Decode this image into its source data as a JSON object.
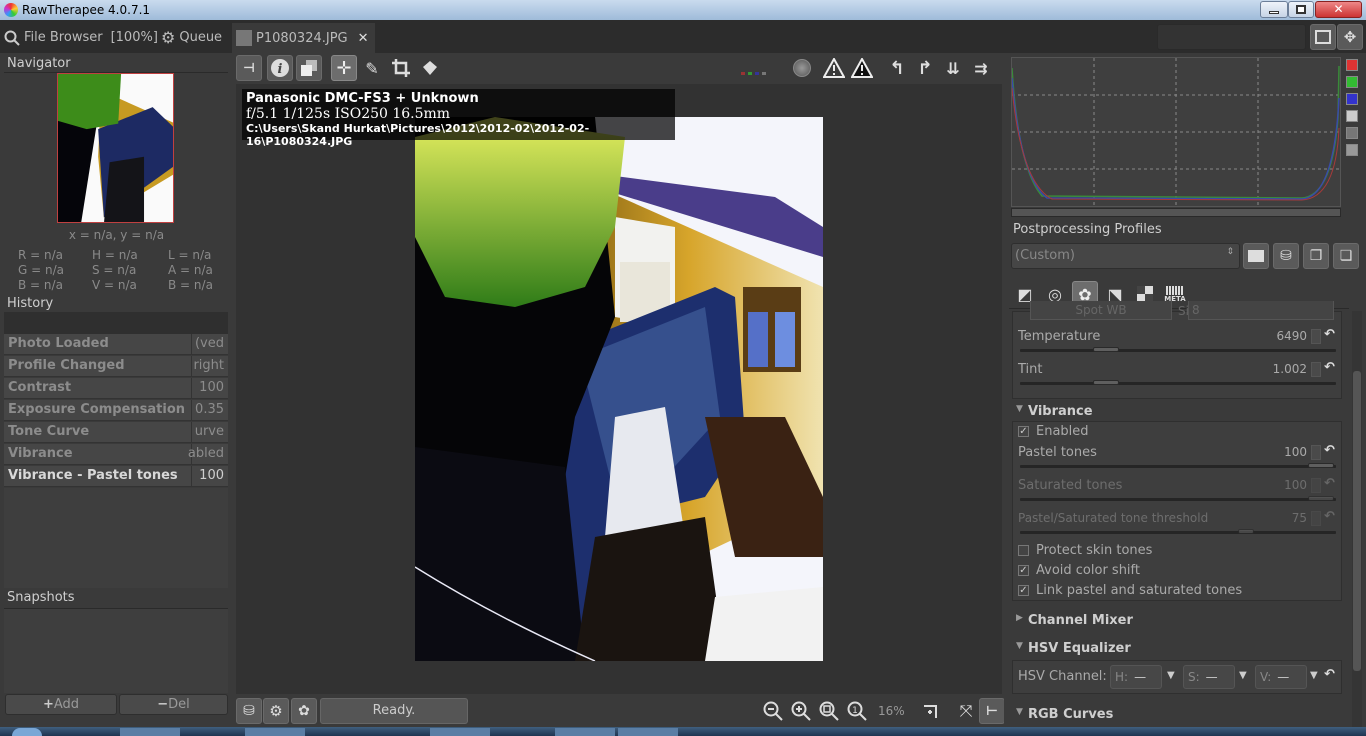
{
  "window": {
    "title": "RawTherapee 4.0.7.1"
  },
  "tabs": {
    "file_browser": "File Browser",
    "zoom_badge": "[100%]",
    "queue": "Queue",
    "image_tab": "P1080324.JPG"
  },
  "navigator": {
    "title": "Navigator",
    "coords": "x = n/a, y = n/a",
    "values": [
      [
        "R = n/a",
        "H = n/a",
        "L = n/a"
      ],
      [
        "G = n/a",
        "S = n/a",
        "A = n/a"
      ],
      [
        "B = n/a",
        "V = n/a",
        "B = n/a"
      ]
    ]
  },
  "history": {
    "title": "History",
    "rows": [
      {
        "name": "Photo Loaded",
        "value": "ved)"
      },
      {
        "name": "Profile Changed",
        "value": "right"
      },
      {
        "name": "Contrast",
        "value": "100"
      },
      {
        "name": "Exposure Compensation",
        "value": "0.35"
      },
      {
        "name": "Tone Curve",
        "value": "urve"
      },
      {
        "name": "Vibrance",
        "value": "abled"
      },
      {
        "name": "Vibrance - Pastel tones",
        "value": "100"
      }
    ]
  },
  "snapshots": {
    "title": "Snapshots",
    "add": "Add",
    "del": "Del"
  },
  "info_overlay": {
    "camera": "Panasonic DMC-FS3 + Unknown",
    "exposure": "f/5.1  1/125s  ISO250  16.5mm",
    "path": "C:\\Users\\Skand Hurkat\\Pictures\\2012\\2012-02\\2012-02-16\\P1080324.JPG"
  },
  "status": {
    "text": "Ready.",
    "zoom": "16%"
  },
  "profiles": {
    "title": "Postprocessing Profiles",
    "selected": "(Custom)"
  },
  "wb": {
    "spot_label": "Spot WB",
    "size_label": "Size:",
    "size_value": "8",
    "temperature_label": "Temperature",
    "temperature_value": "6490",
    "temperature_pos": 0.25,
    "tint_label": "Tint",
    "tint_value": "1.002",
    "tint_pos": 0.25
  },
  "vibrance": {
    "title": "Vibrance",
    "enabled_label": "Enabled",
    "pastel_label": "Pastel tones",
    "pastel_value": "100",
    "saturated_label": "Saturated tones",
    "saturated_value": "100",
    "threshold_label": "Pastel/Saturated tone threshold",
    "threshold_value": "75",
    "protect_skin": "Protect skin tones",
    "avoid_shift": "Avoid color shift",
    "link_tones": "Link pastel and saturated tones"
  },
  "channel_mixer": {
    "title": "Channel Mixer"
  },
  "hsv": {
    "title": "HSV Equalizer",
    "channel_label": "HSV Channel:",
    "h": "H:",
    "s": "S:",
    "v": "V:"
  },
  "rgb_curves": {
    "title": "RGB Curves"
  },
  "toolpanel_tabs": {
    "meta": "META"
  },
  "colors": {
    "accent": "#d84040",
    "panel": "#3a3a3a",
    "dark": "#2c2c2c"
  }
}
